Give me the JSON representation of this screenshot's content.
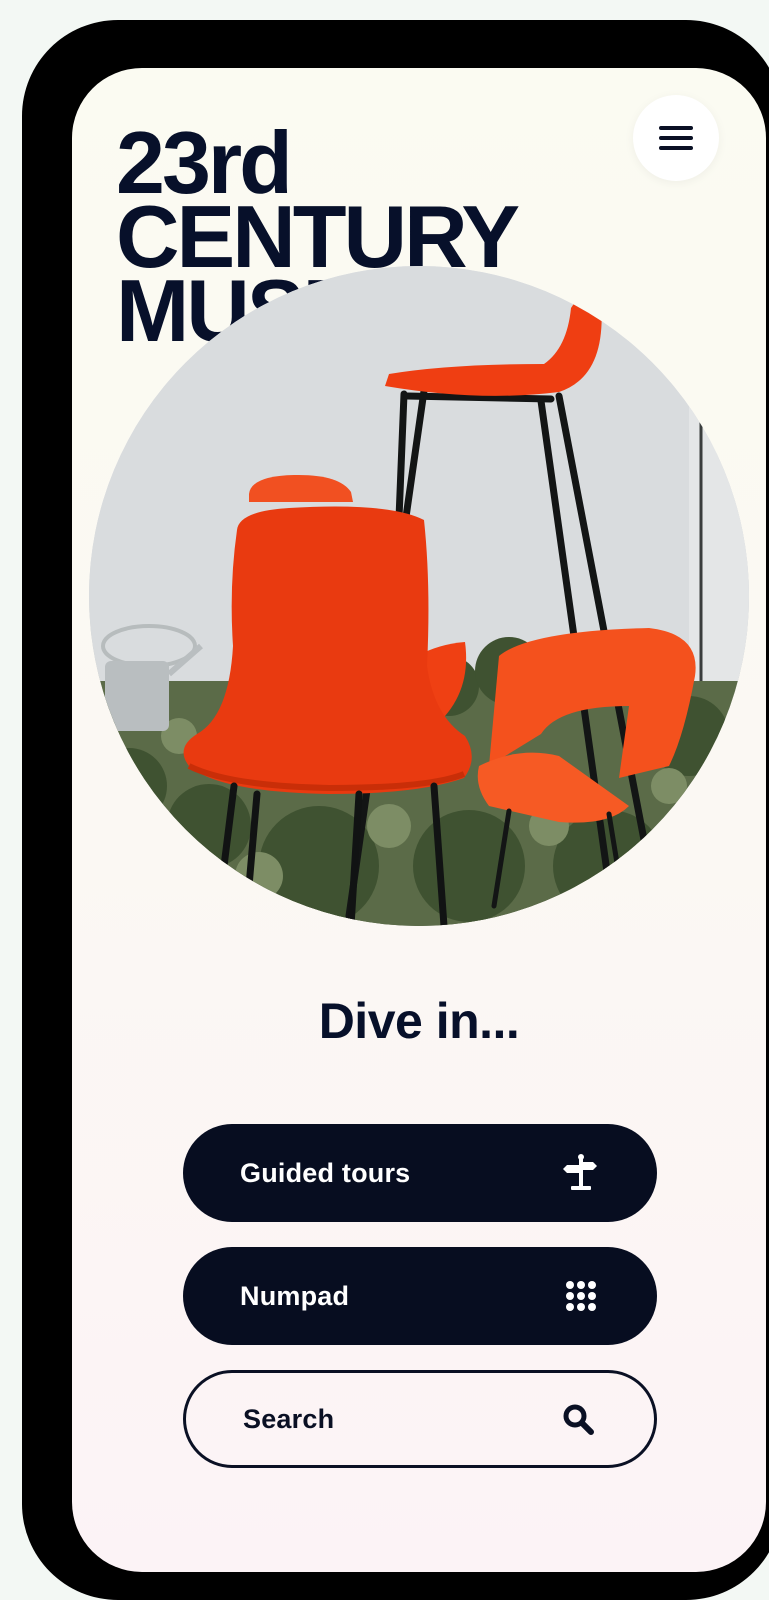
{
  "header": {
    "title_line1": "23rd",
    "title_line2": "CENTURY",
    "title_line3": "MUSEUM",
    "menu_icon": "hamburger-menu-icon"
  },
  "hero": {
    "subject": "orange chairs"
  },
  "main": {
    "headline": "Dive in...",
    "buttons": [
      {
        "label": "Guided tours",
        "icon": "signpost-icon"
      },
      {
        "label": "Numpad",
        "icon": "keypad-grid-icon"
      },
      {
        "label": "Search",
        "icon": "search-icon"
      }
    ]
  },
  "colors": {
    "ink": "#07102a",
    "accent": "#ff4411",
    "background": "#fbfaf4"
  }
}
